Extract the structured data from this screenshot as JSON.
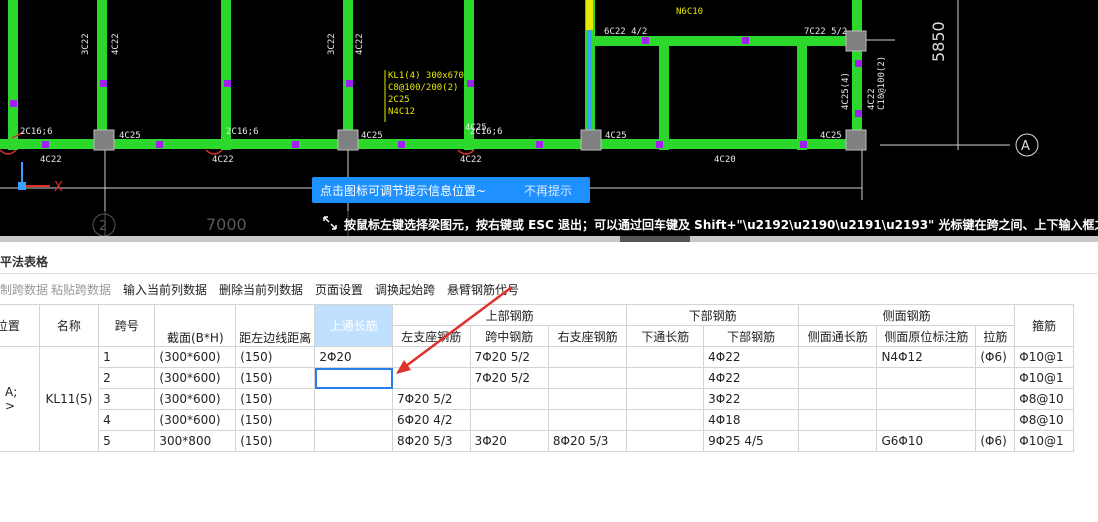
{
  "cad": {
    "grid_labels": [
      "2",
      "A"
    ],
    "dim_text": [
      "7000",
      "5850"
    ],
    "axis_label": "X",
    "rebar_labels": [
      "2C16;6",
      "2C16;6",
      "2C16;6",
      "4C25",
      "4C25",
      "4C25",
      "4C25",
      "4C25",
      "4C22",
      "4C22",
      "4C22",
      "4C20",
      "3C22",
      "4C22",
      "3C22",
      "4C22",
      "6C22 4/2",
      "7C22 5/2",
      "N6C10",
      "C10@100(2)",
      "4C25(4)",
      "4C22"
    ],
    "beam_annotation": [
      "KL1(4) 300x670",
      "C8@100/200(2)",
      "2C25",
      "N4C12"
    ],
    "tip": {
      "message": "点击图标可调节提示信息位置~",
      "dismiss": "不再提示"
    },
    "status": "按鼠标左键选择梁图元，按右键或 ESC 退出；可以通过回车键及 Shift+\"\\u2192\\u2190\\u2191\\u2193\" 光标键在跨之间、上下输入框之间进行切换"
  },
  "panel": {
    "title": "平法表格"
  },
  "toolbar": {
    "items": [
      {
        "label": "复制跨数据",
        "enabled": false
      },
      {
        "label": "粘贴跨数据",
        "enabled": false
      },
      {
        "label": "输入当前列数据",
        "enabled": true
      },
      {
        "label": "删除当前列数据",
        "enabled": true
      },
      {
        "label": "页面设置",
        "enabled": true
      },
      {
        "label": "调换起始跨",
        "enabled": true
      },
      {
        "label": "悬臂钢筋代号",
        "enabled": true
      }
    ]
  },
  "table": {
    "headers": {
      "position": "位置",
      "name": "名称",
      "span": "跨号",
      "section": "截面(B*H)",
      "offset": "距左边线距离",
      "top_through": "上通长筋",
      "top_group": "上部钢筋",
      "top_left": "左支座钢筋",
      "top_mid": "跨中钢筋",
      "top_right": "右支座钢筋",
      "bottom_group": "下部钢筋",
      "bottom_through": "下通长筋",
      "bottom_rebar": "下部钢筋",
      "side_group": "侧面钢筋",
      "side_through": "侧面通长筋",
      "side_orig": "侧面原位标注筋",
      "tie": "拉筋",
      "stirrup": "箍筋"
    },
    "position_value": "A;",
    "position_value2": ">",
    "name_value": "KL11(5)",
    "rows": [
      {
        "span": "1",
        "section": "(300*600)",
        "offset": "(150)",
        "top_through": "2Φ20",
        "top_left": "",
        "top_mid": "7Φ20 5/2",
        "top_right": "",
        "bottom_through": "",
        "bottom_rebar": "4Φ22",
        "side_through": "",
        "side_orig": "N4Φ12",
        "tie": "(Φ6)",
        "stirrup": "Φ10@1"
      },
      {
        "span": "2",
        "section": "(300*600)",
        "offset": "(150)",
        "top_through": "",
        "top_left": "",
        "top_mid": "7Φ20 5/2",
        "top_right": "",
        "bottom_through": "",
        "bottom_rebar": "4Φ22",
        "side_through": "",
        "side_orig": "",
        "tie": "",
        "stirrup": "Φ10@1"
      },
      {
        "span": "3",
        "section": "(300*600)",
        "offset": "(150)",
        "top_through": "",
        "top_left": "7Φ20 5/2",
        "top_mid": "",
        "top_right": "",
        "bottom_through": "",
        "bottom_rebar": "3Φ22",
        "side_through": "",
        "side_orig": "",
        "tie": "",
        "stirrup": "Φ8@10"
      },
      {
        "span": "4",
        "section": "(300*600)",
        "offset": "(150)",
        "top_through": "",
        "top_left": "6Φ20 4/2",
        "top_mid": "",
        "top_right": "",
        "bottom_through": "",
        "bottom_rebar": "4Φ18",
        "side_through": "",
        "side_orig": "",
        "tie": "",
        "stirrup": "Φ8@10"
      },
      {
        "span": "5",
        "section": "300*800",
        "offset": "(150)",
        "top_through": "",
        "top_left": "8Φ20 5/3",
        "top_mid": "3Φ20",
        "top_right": "8Φ20 5/3",
        "bottom_through": "",
        "bottom_rebar": "9Φ25 4/5",
        "side_through": "",
        "side_orig": "G6Φ10",
        "tie": "(Φ6)",
        "stirrup": "Φ10@1"
      }
    ]
  },
  "colors": {
    "beam": "#2bd82b",
    "column": "#808080",
    "accent": "#1e90ff",
    "arrow": "#e0302a",
    "annotation": "#e8e800",
    "node": "#a020f0"
  }
}
